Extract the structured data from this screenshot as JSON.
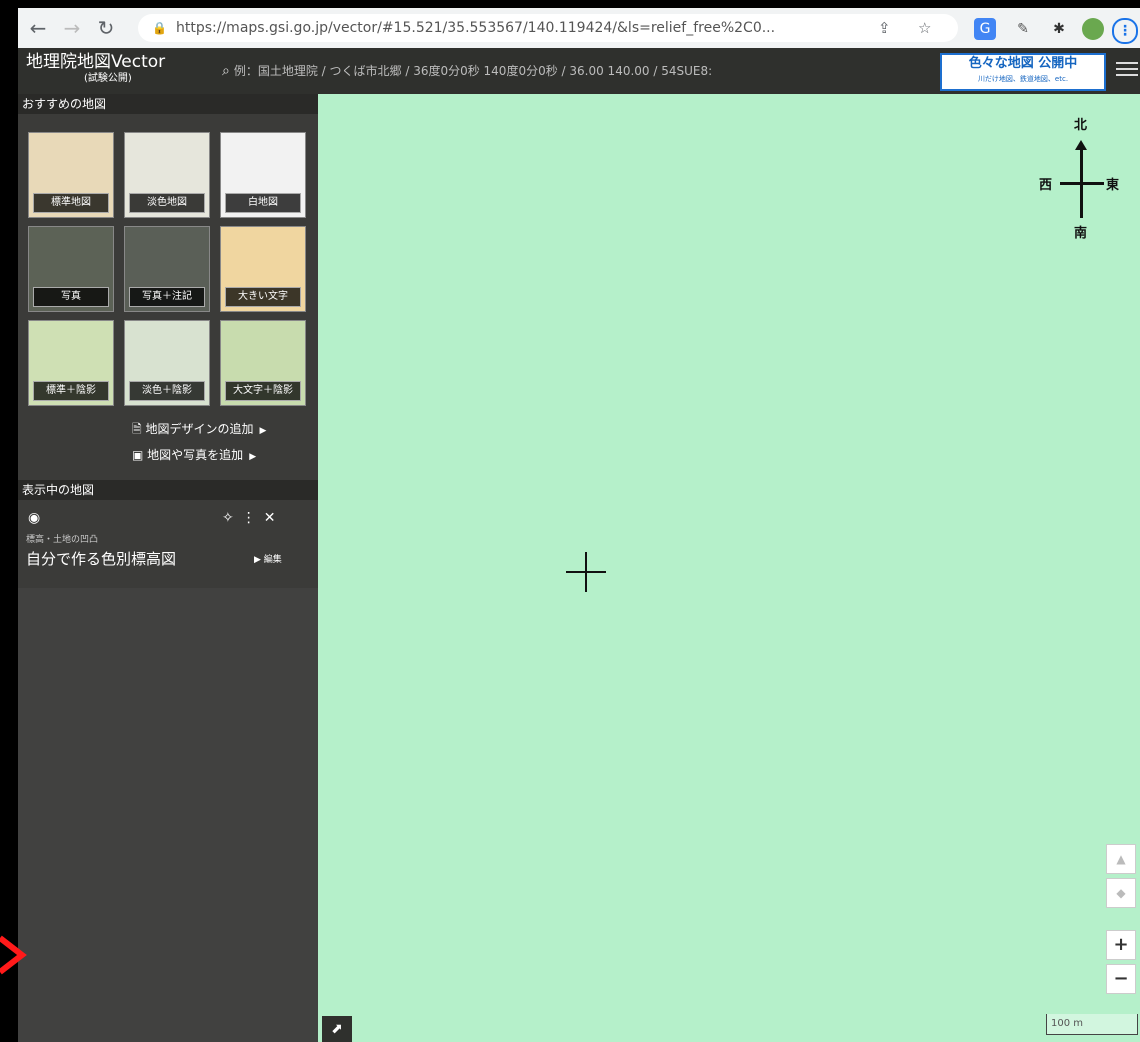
{
  "browser": {
    "url": "https://maps.gsi.go.jp/vector/#15.521/35.553567/140.119424/&ls=relief_free%2C0...",
    "back_icon": "arrow-left",
    "forward_icon": "arrow-right",
    "reload_icon": "reload"
  },
  "header": {
    "logo_title": "地理院地図Vector",
    "logo_subtitle": "(試験公開)",
    "search_placeholder": "例：国土地理院 / つくば市北郷 / 36度0分0秒 140度0分0秒 / 36.00 140.00 / 54SUE8:",
    "banner_title": "色々な地図 公開中",
    "banner_sub": "川だけ地図、鉄道地図、etc."
  },
  "sidebar": {
    "recommended_title": "おすすめの地図",
    "tiles": [
      {
        "label": "標準地図",
        "color": "#e8d9b8"
      },
      {
        "label": "淡色地図",
        "color": "#e6e6dc"
      },
      {
        "label": "白地図",
        "color": "#f2f2f2"
      },
      {
        "label": "写真",
        "color": "#5c6256"
      },
      {
        "label": "写真＋注記",
        "color": "#5a5f57"
      },
      {
        "label": "大きい文字",
        "color": "#f0d6a0"
      },
      {
        "label": "標準＋陰影",
        "color": "#cfe0b4"
      },
      {
        "label": "淡色＋陰影",
        "color": "#d8e2d0"
      },
      {
        "label": "大文字＋陰影",
        "color": "#c8dcae"
      }
    ],
    "add_design_label": "地図デザインの追加",
    "add_photo_label": "地図や写真を追加",
    "displayed_title": "表示中の地図",
    "layer_sub": "標高・土地の凹凸",
    "layer_name": "自分で作る色別標高図",
    "layer_edit": "編集"
  },
  "map": {
    "compass": {
      "north": "北",
      "south": "南",
      "east": "東",
      "west": "西"
    },
    "scale_label": "100 m",
    "bg_color": "#b5f0ca"
  }
}
